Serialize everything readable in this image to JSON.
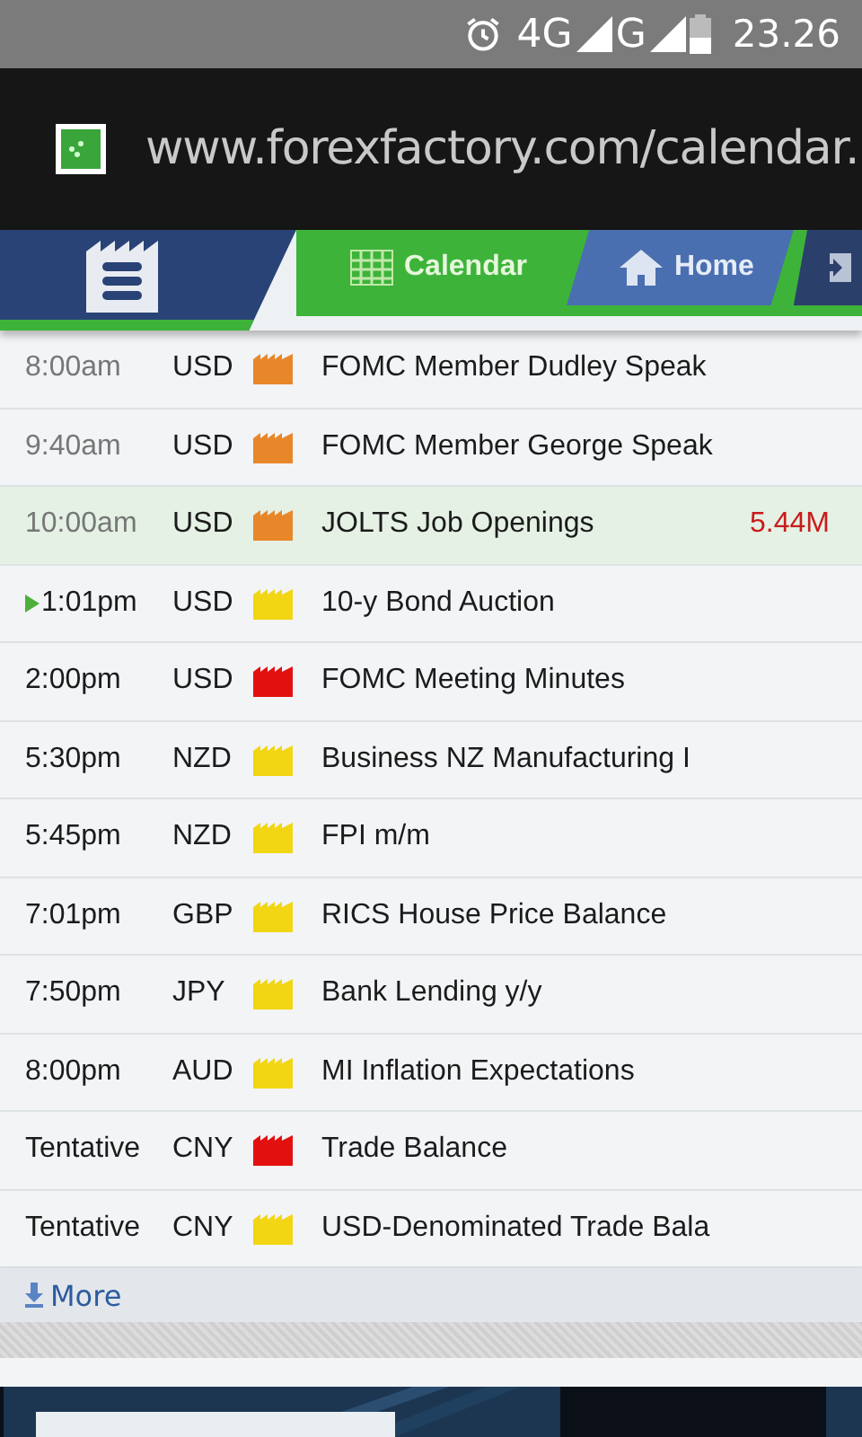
{
  "status_bar": {
    "network_1": "4G",
    "network_2": "G",
    "time": "23.26"
  },
  "address_bar": {
    "url": "www.forexfactory.com/calendar."
  },
  "nav": {
    "tabs": [
      {
        "label": "Calendar",
        "selected": true
      },
      {
        "label": "Home",
        "selected": false
      }
    ]
  },
  "events": [
    {
      "time": "8:00am",
      "currency": "USD",
      "color": "#e8872a",
      "title": "FOMC Member Dudley Speak",
      "past": true,
      "next": false,
      "selected": false
    },
    {
      "time": "9:40am",
      "currency": "USD",
      "color": "#e8872a",
      "title": "FOMC Member George Speak",
      "past": true,
      "next": false,
      "selected": false
    },
    {
      "time": "10:00am",
      "currency": "USD",
      "color": "#e8872a",
      "title": "JOLTS Job Openings",
      "actual": "5.44M",
      "past": true,
      "next": false,
      "selected": true
    },
    {
      "time": "1:01pm",
      "currency": "USD",
      "color": "#f2d614",
      "title": "10-y Bond Auction",
      "past": false,
      "next": true,
      "selected": false
    },
    {
      "time": "2:00pm",
      "currency": "USD",
      "color": "#e31010",
      "title": "FOMC Meeting Minutes",
      "past": false,
      "next": false,
      "selected": false
    },
    {
      "time": "5:30pm",
      "currency": "NZD",
      "color": "#f2d614",
      "title": "Business NZ Manufacturing I",
      "past": false,
      "next": false,
      "selected": false
    },
    {
      "time": "5:45pm",
      "currency": "NZD",
      "color": "#f2d614",
      "title": "FPI m/m",
      "past": false,
      "next": false,
      "selected": false
    },
    {
      "time": "7:01pm",
      "currency": "GBP",
      "color": "#f2d614",
      "title": "RICS House Price Balance",
      "past": false,
      "next": false,
      "selected": false
    },
    {
      "time": "7:50pm",
      "currency": "JPY",
      "color": "#f2d614",
      "title": "Bank Lending y/y",
      "past": false,
      "next": false,
      "selected": false
    },
    {
      "time": "8:00pm",
      "currency": "AUD",
      "color": "#f2d614",
      "title": "MI Inflation Expectations",
      "past": false,
      "next": false,
      "selected": false
    },
    {
      "time": "Tentative",
      "currency": "CNY",
      "color": "#e31010",
      "title": "Trade Balance",
      "past": false,
      "next": false,
      "selected": false
    },
    {
      "time": "Tentative",
      "currency": "CNY",
      "color": "#f2d614",
      "title": "USD-Denominated Trade Bala",
      "past": false,
      "next": false,
      "selected": false
    }
  ],
  "more_link": "More"
}
